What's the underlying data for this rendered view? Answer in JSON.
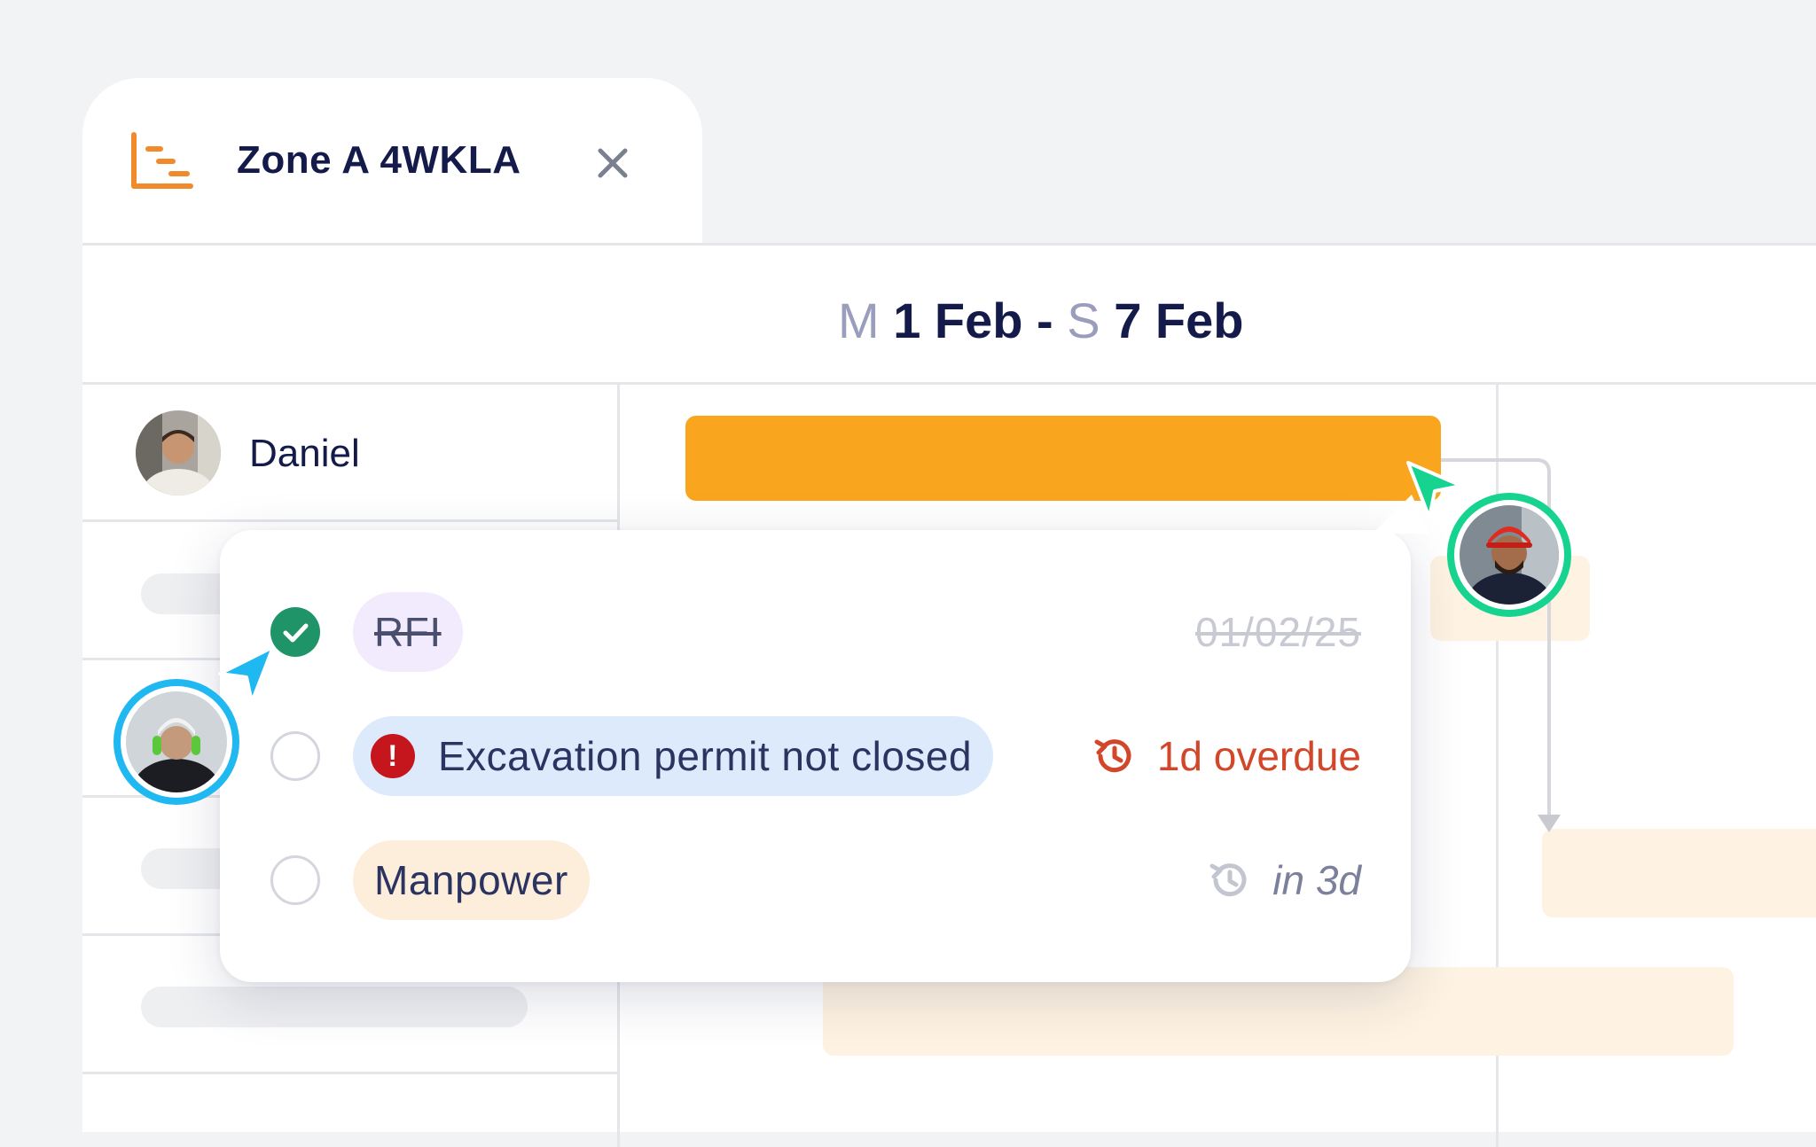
{
  "tab": {
    "title": "Zone A 4WKLA",
    "close_icon": "close-icon",
    "icon": "gantt-icon"
  },
  "date_range": {
    "start_day": "M",
    "start_date": "1 Feb",
    "separator": "-",
    "end_day": "S",
    "end_date": "7 Feb"
  },
  "rows": [
    {
      "name": "Daniel"
    }
  ],
  "popup": {
    "items": [
      {
        "label": "RFI",
        "status": "done",
        "meta": "01/02/25"
      },
      {
        "label": "Excavation permit not closed",
        "status": "open",
        "alert": "!",
        "meta": "1d overdue"
      },
      {
        "label": "Manpower",
        "status": "open",
        "meta": "in 3d"
      }
    ]
  },
  "colors": {
    "bar_orange": "#f9a61e",
    "bar_light": "#fef3e2",
    "done_green": "#1f9468",
    "overdue_red": "#d2462a",
    "cursor_teal": "#16d38f",
    "cursor_blue": "#1fb8f0"
  }
}
